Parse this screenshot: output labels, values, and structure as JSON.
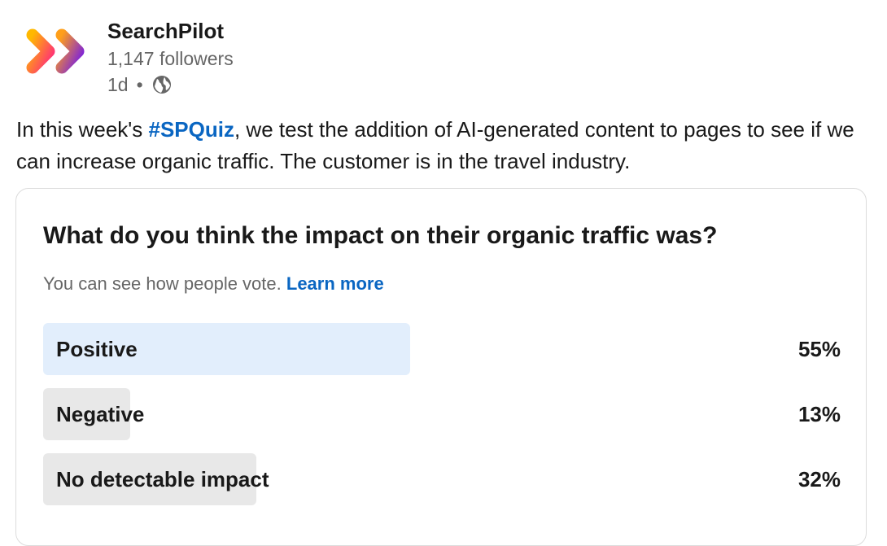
{
  "post": {
    "author": {
      "name": "SearchPilot",
      "followers": "1,147 followers",
      "time": "1d",
      "separator": "•",
      "visibility_icon": "globe-icon",
      "logo_icon": "searchpilot-logo-icon"
    },
    "text": {
      "before_hashtag": "In this week's ",
      "hashtag": "#SPQuiz",
      "after_hashtag": ", we test the addition of AI-generated content to pages to see if we can increase organic traffic. The customer is in the travel industry."
    }
  },
  "poll": {
    "question": "What do you think the impact on their organic traffic was?",
    "note": "You can see how people vote.",
    "learn_more": "Learn more",
    "options": [
      {
        "label": "Positive",
        "percent_label": "55%",
        "percent": 55,
        "leading": true
      },
      {
        "label": "Negative",
        "percent_label": "13%",
        "percent": 13,
        "leading": false
      },
      {
        "label": "No detectable impact",
        "percent_label": "32%",
        "percent": 32,
        "leading": false
      }
    ]
  },
  "colors": {
    "link": "#0a66c2",
    "leading_bar": "#e2eefc",
    "other_bar": "#e8e8e8",
    "logo_gradient": [
      "#ffb800",
      "#ff2d7a",
      "#7a1fe0"
    ]
  }
}
